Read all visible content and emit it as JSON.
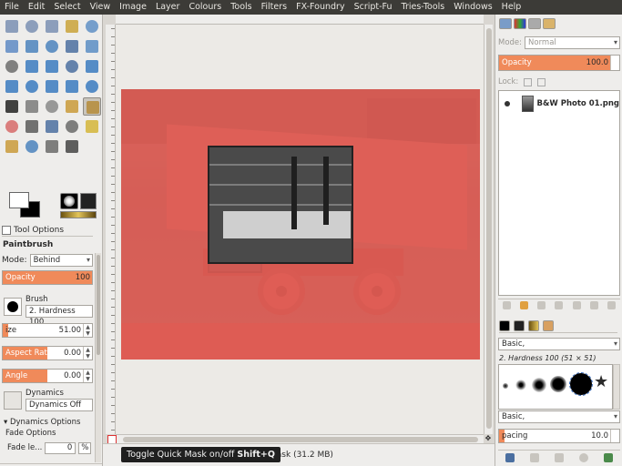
{
  "menubar": [
    "File",
    "Edit",
    "Select",
    "View",
    "Image",
    "Layer",
    "Colours",
    "Tools",
    "Filters",
    "FX-Foundry",
    "Script-Fu",
    "Tries-Tools",
    "Windows",
    "Help"
  ],
  "toolbox": {
    "tools": [
      {
        "name": "rect-select-icon",
        "color": "#7a8fb3"
      },
      {
        "name": "ellipse-select-icon",
        "color": "#7a8fb3"
      },
      {
        "name": "free-select-icon",
        "color": "#7a8fb3"
      },
      {
        "name": "fuzzy-select-icon",
        "color": "#c9a23a"
      },
      {
        "name": "color-select-icon",
        "color": "#5f8fc6"
      },
      {
        "name": "scissors-select-icon",
        "color": "#5e8ac4"
      },
      {
        "name": "foreground-select-icon",
        "color": "#4b82bd"
      },
      {
        "name": "paths-icon",
        "color": "#4b82bd"
      },
      {
        "name": "color-picker-icon",
        "color": "#4b6fa0"
      },
      {
        "name": "zoom-icon",
        "color": "#5a8dc4"
      },
      {
        "name": "measure-icon",
        "color": "#6c6c6c"
      },
      {
        "name": "move-icon",
        "color": "#3a7ac0"
      },
      {
        "name": "align-icon",
        "color": "#3a7ac0"
      },
      {
        "name": "crop-icon",
        "color": "#4b6fa0"
      },
      {
        "name": "rotate-icon",
        "color": "#3a7ac0"
      },
      {
        "name": "scale-icon",
        "color": "#3a7ac0"
      },
      {
        "name": "shear-icon",
        "color": "#3a7ac0"
      },
      {
        "name": "perspective-icon",
        "color": "#3a7ac0"
      },
      {
        "name": "flip-icon",
        "color": "#3a7ac0"
      },
      {
        "name": "cage-transform-icon",
        "color": "#3a7ac0"
      },
      {
        "name": "text-icon",
        "color": "#222222"
      },
      {
        "name": "bucket-fill-icon",
        "color": "#7a7a7a"
      },
      {
        "name": "blend-icon",
        "color": "#888888"
      },
      {
        "name": "pencil-icon",
        "color": "#c99a3a"
      },
      {
        "name": "paintbrush-icon",
        "color": "#b58b3a"
      },
      {
        "name": "eraser-icon",
        "color": "#d66a6a"
      },
      {
        "name": "airbrush-icon",
        "color": "#5a5a5a"
      },
      {
        "name": "ink-icon",
        "color": "#4b6fa0"
      },
      {
        "name": "myPaint-brush-icon",
        "color": "#6a6a6a"
      },
      {
        "name": "clone-icon",
        "color": "#d4b53a"
      },
      {
        "name": "perspective-clone-icon",
        "color": "#c99a3a"
      },
      {
        "name": "blur-icon",
        "color": "#4b82bd"
      },
      {
        "name": "smudge-icon",
        "color": "#6a6a6a"
      },
      {
        "name": "dodge-burn-icon",
        "color": "#444444"
      }
    ],
    "active_tool_index": 24,
    "tab_label": "Tool Options",
    "tool_name": "Paintbrush",
    "mode_label": "Mode:",
    "mode_value": "Behind",
    "opacity": {
      "label": "Opacity",
      "value": "100"
    },
    "brush_label": "Brush",
    "brush_name": "2. Hardness 100",
    "size": {
      "label": "ize",
      "value": "51.00"
    },
    "aspect_ratio": {
      "label": "Aspect Ratio",
      "value": "0.00"
    },
    "angle": {
      "label": "Angle",
      "value": "0.00"
    },
    "dynamics_label": "Dynamics",
    "dynamics_value": "Dynamics Off",
    "dynamics_options": "Dynamics Options",
    "fade_options": "Fade Options",
    "fade_length": {
      "label": "Fade le...",
      "value": "0",
      "unit": "%"
    }
  },
  "canvas": {
    "status": "ck Mask (31.2 MB)",
    "tooltip_text": "Toggle Quick Mask on/off",
    "tooltip_shortcut": "Shift+Q"
  },
  "layers": {
    "mode_label": "Mode:",
    "mode_value": "Normal",
    "opacity_label": "Opacity",
    "opacity_value": "100.0",
    "lock_label": "Lock:",
    "layer_name": "B&W Photo 01.png"
  },
  "brushes": {
    "tag_filter": "Basic,",
    "brush_title": "2. Hardness 100 (51 × 51)",
    "tag_entry": "Basic,",
    "spacing_label": "pacing",
    "spacing_value": "10.0"
  },
  "colors": {
    "mask_red": "#f06058",
    "slider_orange": "#f08a5a",
    "menubar_bg": "#3c3b37"
  }
}
